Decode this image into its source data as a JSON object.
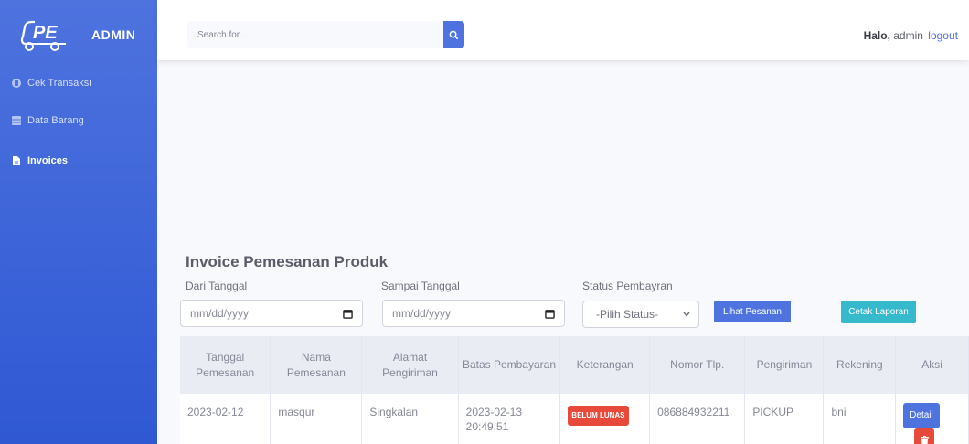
{
  "brand": {
    "logo_text": "PE",
    "name": "ADMIN"
  },
  "sidebar": {
    "items": [
      {
        "label": "Cek Transaksi",
        "icon": "receipt-icon",
        "active": false
      },
      {
        "label": "Data Barang",
        "icon": "table-icon",
        "active": false
      },
      {
        "label": "Invoices",
        "icon": "file-icon",
        "active": true
      }
    ]
  },
  "topbar": {
    "search_placeholder": "Search for...",
    "greeting_bold": "Halo,",
    "greeting_user": " admin",
    "logout_label": "logout"
  },
  "page": {
    "title": "Invoice Pemesanan Produk",
    "filters": {
      "from_label": "Dari Tanggal",
      "from_placeholder": "mm/dd/yyyy",
      "to_label": "Sampai Tanggal",
      "to_placeholder": "mm/dd/yyyy",
      "status_label": "Status Pembayran",
      "status_selected": "-Pilih Status-",
      "view_button": "Lihat Pesanan",
      "print_button": "Cetak Laporan"
    }
  },
  "table": {
    "columns": [
      "Tanggal Pemesanan",
      "Nama Pemesanan",
      "Alamat Pengiriman",
      "Batas Pembayaran",
      "Keterangan",
      "Nomor Tlp.",
      "Pengiriman",
      "Rekening",
      "Aksi"
    ],
    "rows": [
      {
        "tanggal": "2023-02-12",
        "nama": "masqur",
        "alamat": "Singkalan",
        "batas": "2023-02-13 20:49:51",
        "keterangan": "BELUM LUNAS",
        "telp": "086884932211",
        "pengiriman": "PICKUP",
        "rekening": "bni",
        "detail_label": "Detail"
      }
    ]
  },
  "colors": {
    "sidebar": "#4e73df",
    "primary": "#4e73df",
    "info": "#36b9cc",
    "danger": "#e74a3b"
  }
}
